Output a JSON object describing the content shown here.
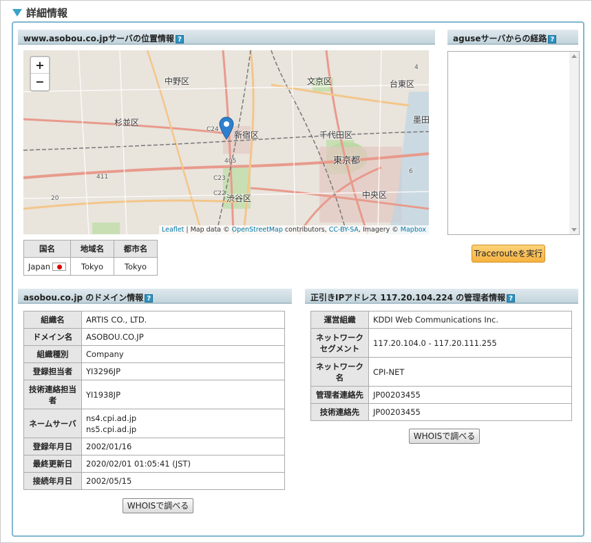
{
  "page": {
    "title": "詳細情報"
  },
  "location": {
    "header": "www.asobou.co.jpサーバの位置情報",
    "help": "?",
    "zoom_in": "+",
    "zoom_out": "−",
    "attribution": {
      "leaflet": "Leaflet",
      "sep1": " | Map data © ",
      "osm": "OpenStreetMap",
      "mid": " contributors, ",
      "cc": "CC-BY-SA",
      "imagery": ", Imagery © ",
      "mapbox": "Mapbox"
    },
    "map_labels": {
      "nakano": "中野区",
      "suginami": "杉並区",
      "shinjuku": "新宿区",
      "shibuya": "渋谷区",
      "bunkyo": "文京区",
      "taito": "台東区",
      "sumida": "墨田",
      "chiyoda": "千代田区",
      "tokyo": "東京都",
      "chuo": "中央区",
      "r_c24": "C24",
      "r_405": "405",
      "r_c23": "C23",
      "r_c22": "C22",
      "r_411": "411",
      "r_r20": "20",
      "r_r4": "4",
      "r_r6": "6"
    },
    "table": {
      "headers": [
        "国名",
        "地域名",
        "都市名"
      ],
      "country": "Japan",
      "region": "Tokyo",
      "city": "Tokyo"
    }
  },
  "traceroute": {
    "header": "aguseサーバからの経路",
    "help": "?",
    "button": "Tracerouteを実行"
  },
  "domain": {
    "header": "asobou.co.jp のドメイン情報",
    "help": "?",
    "rows": [
      {
        "label": "組織名",
        "value": "ARTIS CO., LTD."
      },
      {
        "label": "ドメイン名",
        "value": "ASOBOU.CO.JP"
      },
      {
        "label": "組織種別",
        "value": "Company"
      },
      {
        "label": "登録担当者",
        "value": "YI3296JP"
      },
      {
        "label": "技術連絡担当者",
        "value": "YI1938JP"
      },
      {
        "label": "ネームサーバ",
        "value": "ns4.cpi.ad.jp",
        "value2": "ns5.cpi.ad.jp"
      },
      {
        "label": "登録年月日",
        "value": "2002/01/16"
      },
      {
        "label": "最終更新日",
        "value": "2020/02/01 01:05:41 (JST)"
      },
      {
        "label": "接続年月日",
        "value": "2002/05/15"
      }
    ],
    "whois_button": "WHOISで調べる"
  },
  "ip": {
    "header": "正引きIPアドレス 117.20.104.224 の管理者情報",
    "help": "?",
    "rows": [
      {
        "label": "運営組織",
        "value": "KDDI Web Communications Inc."
      },
      {
        "label": "ネットワークセグメント",
        "value": "117.20.104.0 - 117.20.111.255"
      },
      {
        "label": "ネットワーク名",
        "value": "CPI-NET"
      },
      {
        "label": "管理者連絡先",
        "value": "JP00203455"
      },
      {
        "label": "技術連絡先",
        "value": "JP00203455"
      }
    ],
    "whois_button": "WHOISで調べる"
  },
  "colors": {
    "accent": "#3aa3c6",
    "panel_border": "#7fb7cf",
    "trace_button": "#f6b340",
    "marker": "#2f7fcf"
  }
}
